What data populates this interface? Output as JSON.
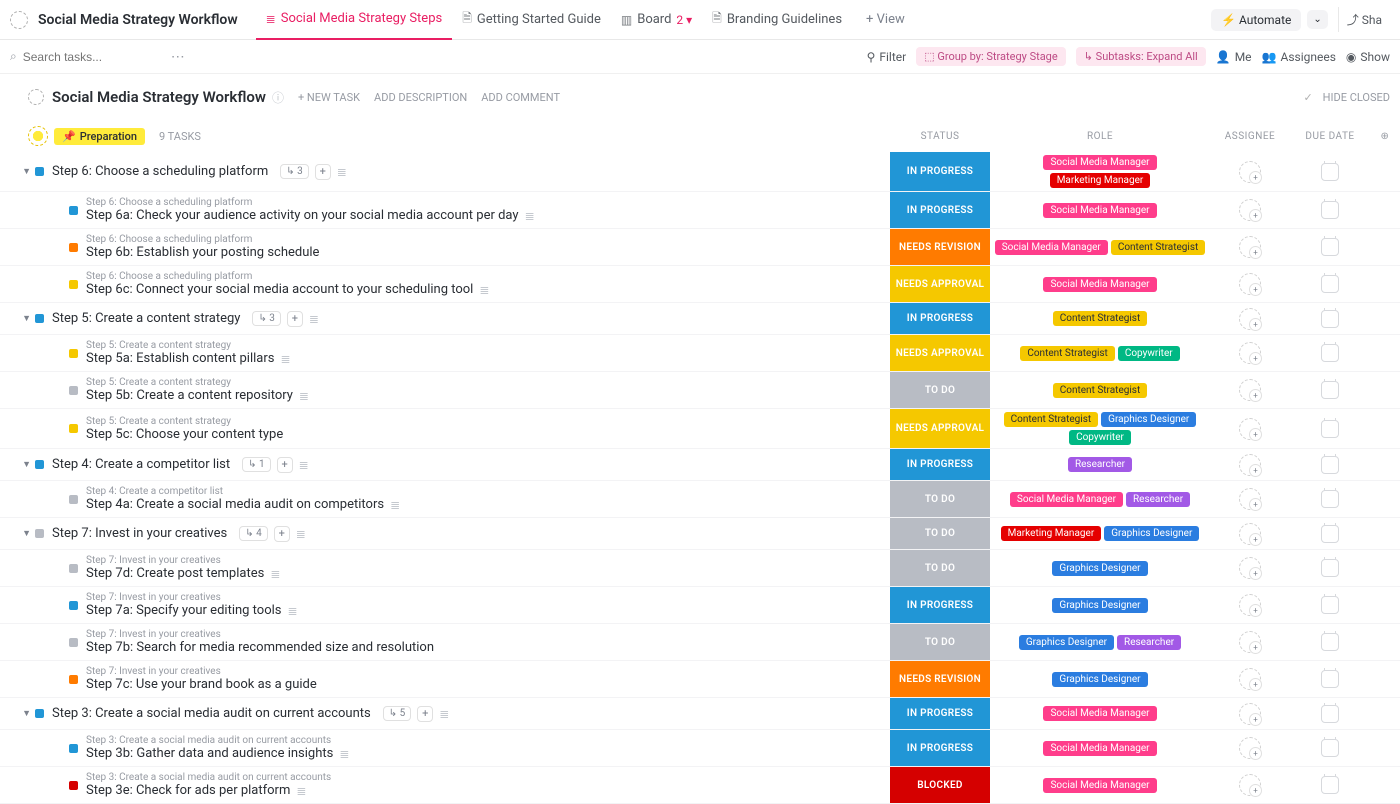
{
  "topbar": {
    "list_title": "Social Media Strategy Workflow",
    "tabs": [
      {
        "icon": "≣",
        "label": "Social Media Strategy Steps",
        "active": true
      },
      {
        "icon": "🗎",
        "label": "Getting Started Guide"
      },
      {
        "icon": "▥",
        "label": "Board",
        "count": "2 ▾"
      },
      {
        "icon": "🗎",
        "label": "Branding Guidelines"
      }
    ],
    "add_view": "+ View",
    "automate": "Automate",
    "share": "Sha"
  },
  "toolbar": {
    "search_ph": "Search tasks...",
    "filter": "Filter",
    "group_by": "Group by: Strategy Stage",
    "subtasks": "Subtasks: Expand All",
    "me": "Me",
    "assignees": "Assignees",
    "show": "Show"
  },
  "header": {
    "title": "Social Media Strategy Workflow",
    "new_task": "+ NEW TASK",
    "add_desc": "ADD DESCRIPTION",
    "add_comment": "ADD COMMENT",
    "hide_closed": "HIDE CLOSED"
  },
  "group": {
    "label": "Preparation",
    "count": "9 TASKS",
    "cols": {
      "status": "STATUS",
      "role": "ROLE",
      "assignee": "ASSIGNEE",
      "due": "DUE DATE"
    }
  },
  "roles": {
    "smm": "Social Media Manager",
    "mm": "Marketing Manager",
    "cs": "Content Strategist",
    "cw": "Copywriter",
    "res": "Researcher",
    "gd": "Graphics Designer"
  },
  "statuses": {
    "inprog": "IN PROGRESS",
    "revision": "NEEDS REVISION",
    "approval": "NEEDS APPROVAL",
    "todo": "TO DO",
    "blocked": "BLOCKED"
  },
  "tasks": [
    {
      "name": "Step 6: Choose a scheduling platform",
      "sq": "blue",
      "expand": true,
      "subcount": "3",
      "status": "inprog",
      "roles": [
        "smm",
        "mm"
      ],
      "doc": true
    },
    {
      "parent": "Step 6: Choose a scheduling platform",
      "name": "Step 6a: Check your audience activity on your social media account per day",
      "sq": "blue",
      "status": "inprog",
      "roles": [
        "smm"
      ],
      "doc": true
    },
    {
      "parent": "Step 6: Choose a scheduling platform",
      "name": "Step 6b: Establish your posting schedule",
      "sq": "orange",
      "status": "revision",
      "roles": [
        "smm",
        "cs"
      ]
    },
    {
      "parent": "Step 6: Choose a scheduling platform",
      "name": "Step 6c: Connect your social media account to your scheduling tool",
      "sq": "yellow",
      "status": "approval",
      "roles": [
        "smm"
      ],
      "doc": true
    },
    {
      "name": "Step 5: Create a content strategy",
      "sq": "blue",
      "expand": true,
      "subcount": "3",
      "status": "inprog",
      "roles": [
        "cs"
      ],
      "doc": true
    },
    {
      "parent": "Step 5: Create a content strategy",
      "name": "Step 5a: Establish content pillars",
      "sq": "yellow",
      "status": "approval",
      "roles": [
        "cs",
        "cw"
      ],
      "doc": true
    },
    {
      "parent": "Step 5: Create a content strategy",
      "name": "Step 5b: Create a content repository",
      "sq": "grey",
      "status": "todo",
      "roles": [
        "cs"
      ],
      "doc": true
    },
    {
      "parent": "Step 5: Create a content strategy",
      "name": "Step 5c: Choose your content type",
      "sq": "yellow",
      "status": "approval",
      "roles": [
        "cs",
        "gd",
        "cw"
      ]
    },
    {
      "name": "Step 4: Create a competitor list",
      "sq": "blue",
      "expand": true,
      "subcount": "1",
      "status": "inprog",
      "roles": [
        "res"
      ],
      "doc": true
    },
    {
      "parent": "Step 4: Create a competitor list",
      "name": "Step 4a: Create a social media audit on competitors",
      "sq": "grey",
      "status": "todo",
      "roles": [
        "smm",
        "res"
      ],
      "doc": true
    },
    {
      "name": "Step 7: Invest in your creatives",
      "sq": "grey",
      "expand": true,
      "subcount": "4",
      "status": "todo",
      "roles": [
        "mm",
        "gd"
      ],
      "doc": true
    },
    {
      "parent": "Step 7: Invest in your creatives",
      "name": "Step 7d: Create post templates",
      "sq": "grey",
      "status": "todo",
      "roles": [
        "gd"
      ],
      "doc": true
    },
    {
      "parent": "Step 7: Invest in your creatives",
      "name": "Step 7a: Specify your editing tools",
      "sq": "blue",
      "status": "inprog",
      "roles": [
        "gd"
      ],
      "doc": true
    },
    {
      "parent": "Step 7: Invest in your creatives",
      "name": "Step 7b: Search for media recommended size and resolution",
      "sq": "grey",
      "status": "todo",
      "roles": [
        "gd",
        "res"
      ]
    },
    {
      "parent": "Step 7: Invest in your creatives",
      "name": "Step 7c: Use your brand book as a guide",
      "sq": "orange",
      "status": "revision",
      "roles": [
        "gd"
      ]
    },
    {
      "name": "Step 3: Create a social media audit on current accounts",
      "sq": "blue",
      "expand": true,
      "subcount": "5",
      "status": "inprog",
      "roles": [
        "smm"
      ],
      "doc": true
    },
    {
      "parent": "Step 3: Create a social media audit on current accounts",
      "name": "Step 3b: Gather data and audience insights",
      "sq": "blue",
      "status": "inprog",
      "roles": [
        "smm"
      ],
      "doc": true
    },
    {
      "parent": "Step 3: Create a social media audit on current accounts",
      "name": "Step 3e: Check for ads per platform",
      "sq": "red",
      "status": "blocked",
      "roles": [
        "smm"
      ],
      "doc": true
    }
  ]
}
